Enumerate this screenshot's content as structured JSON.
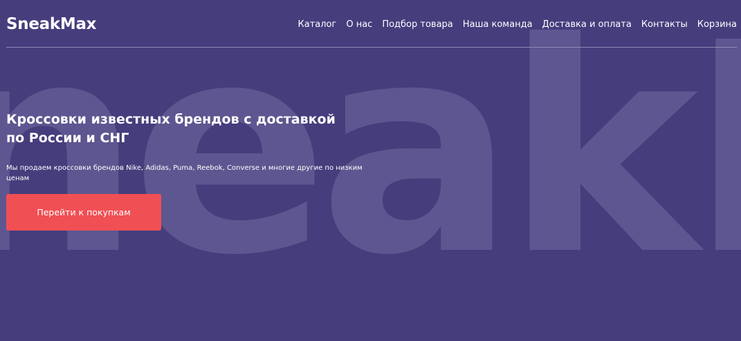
{
  "header": {
    "logo": "SneakMax",
    "nav": [
      {
        "label": "Каталог"
      },
      {
        "label": "О нас"
      },
      {
        "label": "Подбор товара"
      },
      {
        "label": "Наша команда"
      },
      {
        "label": "Доставка и оплата"
      },
      {
        "label": "Контакты"
      },
      {
        "label": "Корзина"
      }
    ]
  },
  "hero": {
    "background_word": "neakM",
    "title": "Кроссовки известных брендов с доставкой по России и СНГ",
    "description": "Мы продаем кроссовки брендов Nike, Adidas, Puma, Reebok, Converse и многие другие по низким ценам",
    "cta_label": "Перейти к покупкам"
  },
  "colors": {
    "background": "#463d7d",
    "watermark": "#5e5690",
    "accent": "#f04f54",
    "text": "#ffffff"
  }
}
